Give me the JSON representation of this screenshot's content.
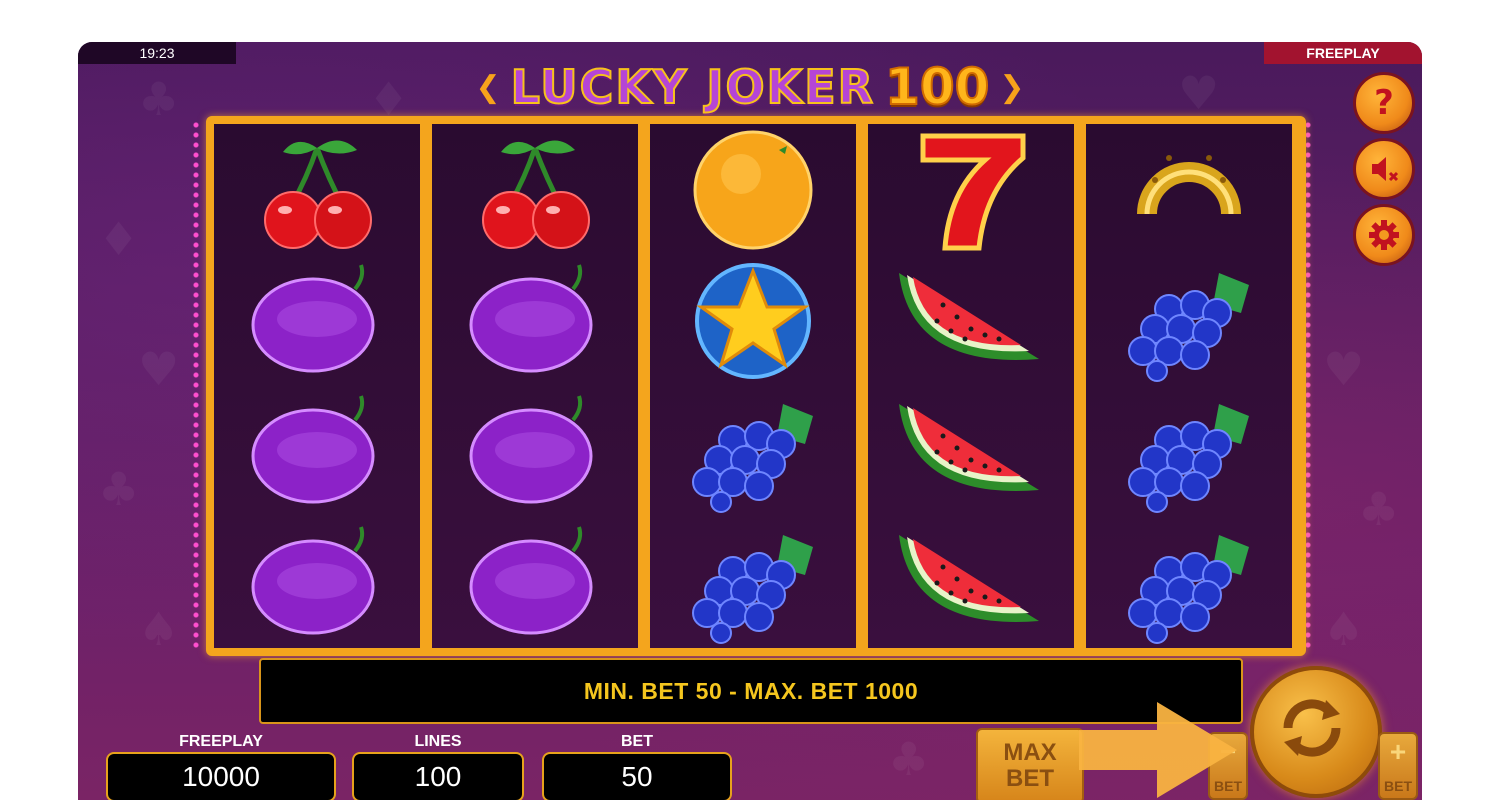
{
  "header": {
    "clock": "19:23",
    "mode_label": "FREEPLAY",
    "logo_title": "LUCKY JOKER",
    "logo_number": "100"
  },
  "side_buttons": [
    {
      "name": "help",
      "icon": "question-icon"
    },
    {
      "name": "sound",
      "icon": "speaker-muted-icon"
    },
    {
      "name": "settings",
      "icon": "gear-icon"
    }
  ],
  "reels": [
    [
      "cherry",
      "plum",
      "plum",
      "plum"
    ],
    [
      "cherry",
      "plum",
      "plum",
      "plum"
    ],
    [
      "orange",
      "star",
      "grapes",
      "grapes"
    ],
    [
      "seven",
      "watermelon",
      "watermelon",
      "watermelon"
    ],
    [
      "horseshoe",
      "grapes",
      "grapes",
      "grapes"
    ]
  ],
  "message": "MIN. BET 50 - MAX. BET 1000",
  "stats": {
    "freeplay_label": "FREEPLAY",
    "freeplay_value": "10000",
    "lines_label": "LINES",
    "lines_value": "100",
    "bet_label": "BET",
    "bet_value": "50"
  },
  "controls": {
    "maxbet_line1": "MAX",
    "maxbet_line2": "BET",
    "bet_minus_label": "BET",
    "bet_plus_label": "BET",
    "bet_minus_symbol": "−",
    "bet_plus_symbol": "+"
  },
  "colors": {
    "frame_gold": "#f4a51d",
    "message_text": "#f5c61e",
    "background_purple": "#5c1f63",
    "freeplay_bar": "#a2132f"
  }
}
